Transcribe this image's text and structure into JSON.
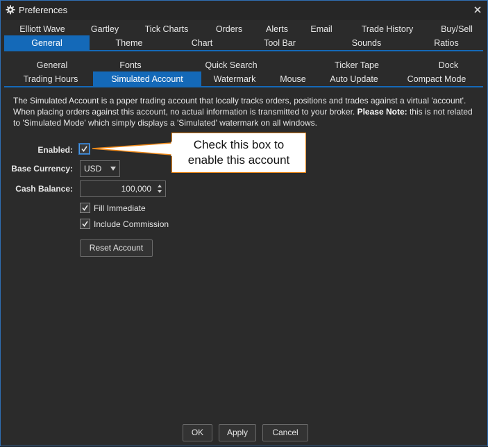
{
  "window": {
    "title": "Preferences",
    "accent": "#1469b8",
    "callout_border": "#f08a1a"
  },
  "main_tabs": {
    "row1": [
      "Elliott Wave",
      "Gartley",
      "Tick Charts",
      "Orders",
      "Alerts",
      "Email",
      "Trade History",
      "Buy/Sell"
    ],
    "row2": [
      "General",
      "Theme",
      "Chart",
      "Tool Bar",
      "Sounds",
      "Ratios"
    ],
    "active": "General"
  },
  "sub_tabs": {
    "row1": [
      "General",
      "Fonts",
      "Quick Search",
      "Ticker Tape",
      "Dock"
    ],
    "row2": [
      "Trading Hours",
      "Simulated Account",
      "Watermark",
      "Mouse",
      "Auto Update",
      "Compact Mode"
    ],
    "active": "Simulated Account"
  },
  "description": {
    "text": "The Simulated Account is a paper trading account that locally tracks orders, positions and trades against a virtual 'account'. When placing orders against this account, no actual information is transmitted to your broker. ",
    "note_label": "Please Note:",
    "note_text": " this is not related to 'Simulated Mode' which simply displays a 'Simulated' watermark on all windows."
  },
  "form": {
    "enabled_label": "Enabled:",
    "enabled_checked": true,
    "currency_label": "Base Currency:",
    "currency_value": "USD",
    "cash_label": "Cash Balance:",
    "cash_value": "100,000",
    "fill_immediate_label": "Fill Immediate",
    "fill_immediate_checked": true,
    "include_commission_label": "Include Commission",
    "include_commission_checked": true,
    "reset_label": "Reset Account"
  },
  "callout": {
    "line1": "Check this box to",
    "line2": "enable this account"
  },
  "footer": {
    "ok_label": "OK",
    "apply_label": "Apply",
    "cancel_label": "Cancel"
  },
  "icons": {
    "title_icon": "gear-icon",
    "close_icon": "close-icon",
    "checkmark": "checkmark-icon"
  }
}
